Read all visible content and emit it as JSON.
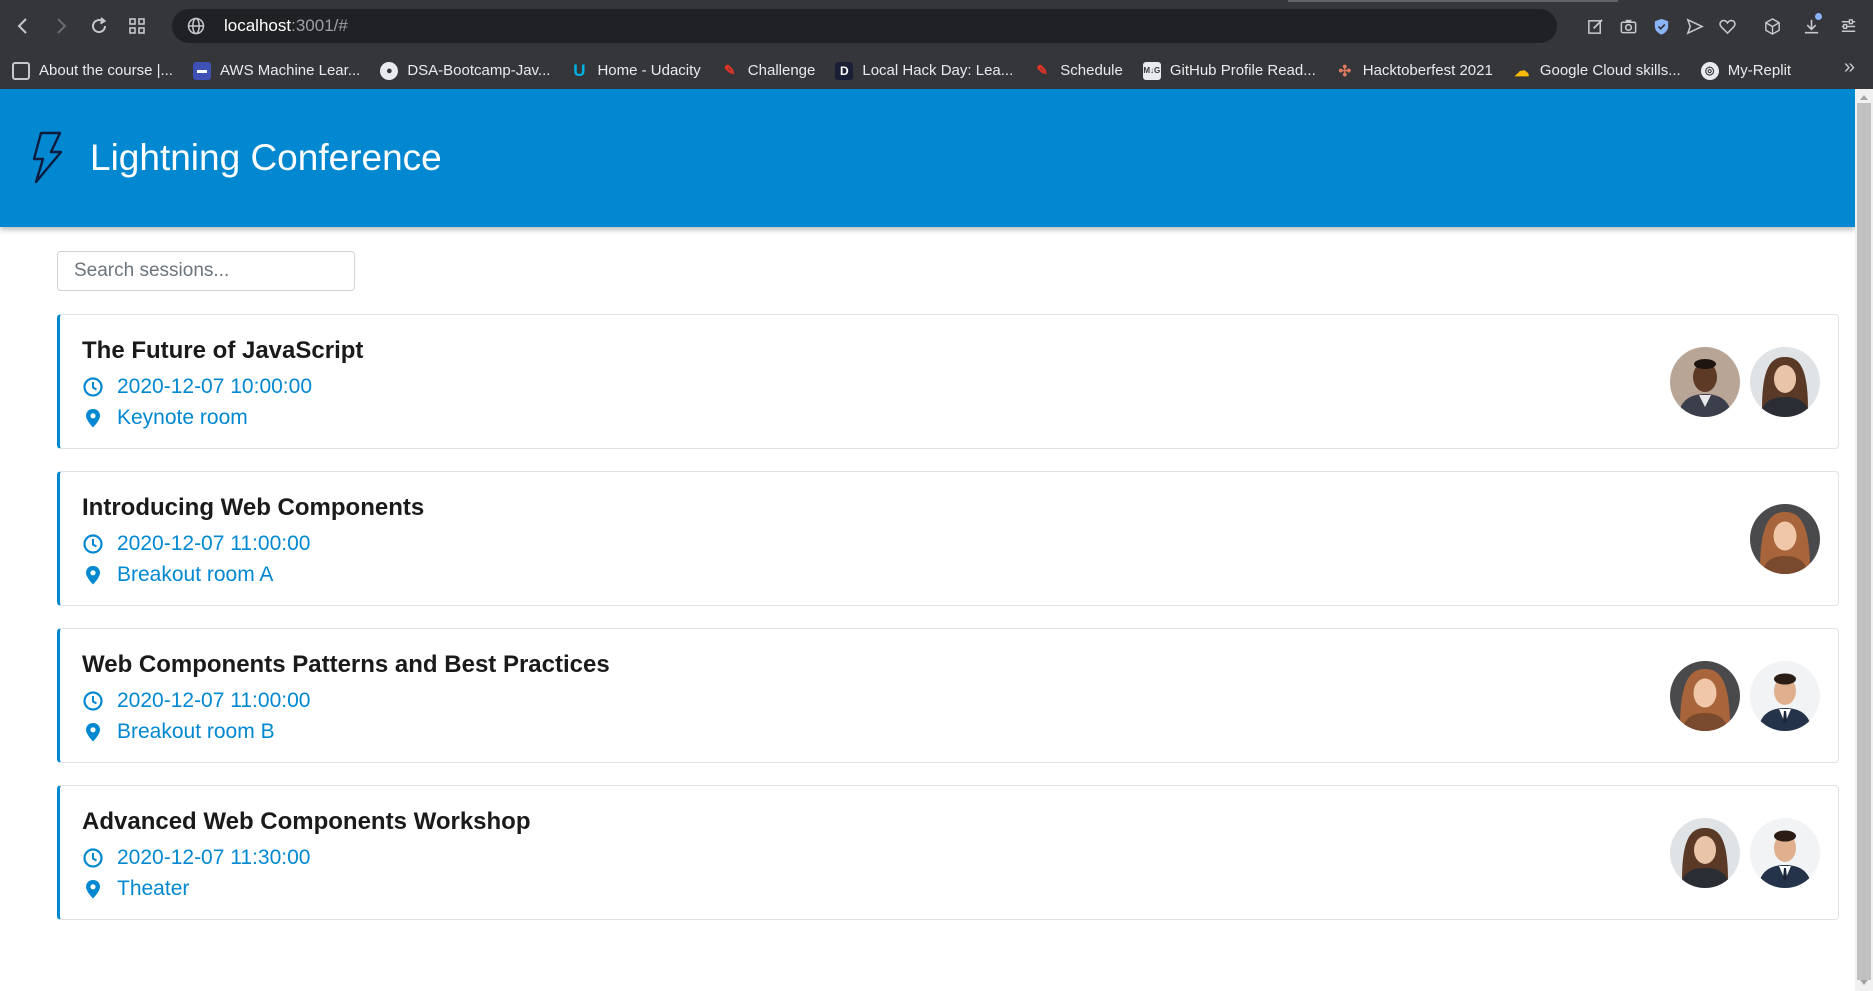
{
  "browser": {
    "url_host": "localhost",
    "url_rest": ":3001/#",
    "bookmarks": [
      {
        "label": "About the course |...",
        "icon": "page-icon"
      },
      {
        "label": "AWS Machine Lear...",
        "icon": "aws-icon"
      },
      {
        "label": "DSA-Bootcamp-Jav...",
        "icon": "github-icon"
      },
      {
        "label": "Home - Udacity",
        "icon": "udacity-icon"
      },
      {
        "label": "Challenge",
        "icon": "mlh-icon"
      },
      {
        "label": "Local Hack Day: Lea...",
        "icon": "devpost-icon"
      },
      {
        "label": "Schedule",
        "icon": "mlh-icon"
      },
      {
        "label": "GitHub Profile Read...",
        "icon": "mdg-icon"
      },
      {
        "label": "Hacktoberfest 2021",
        "icon": "hacktoberfest-icon"
      },
      {
        "label": "Google Cloud skills...",
        "icon": "google-cloud-icon"
      },
      {
        "label": "My-Replit",
        "icon": "replit-icon"
      }
    ]
  },
  "app": {
    "title": "Lightning Conference",
    "search_placeholder": "Search sessions..."
  },
  "sessions": [
    {
      "title": "The Future of JavaScript",
      "time": "2020-12-07 10:00:00",
      "room": "Keynote room",
      "speakers": [
        "man-dark",
        "woman-brunette"
      ]
    },
    {
      "title": "Introducing Web Components",
      "time": "2020-12-07 11:00:00",
      "room": "Breakout room A",
      "speakers": [
        "woman-auburn"
      ]
    },
    {
      "title": "Web Components Patterns and Best Practices",
      "time": "2020-12-07 11:00:00",
      "room": "Breakout room B",
      "speakers": [
        "woman-auburn",
        "man-suit"
      ]
    },
    {
      "title": "Advanced Web Components Workshop",
      "time": "2020-12-07 11:30:00",
      "room": "Theater",
      "speakers": [
        "woman-brunette",
        "man-suit"
      ]
    }
  ],
  "colors": {
    "brand": "#0288d1",
    "chrome": "#35363a"
  }
}
